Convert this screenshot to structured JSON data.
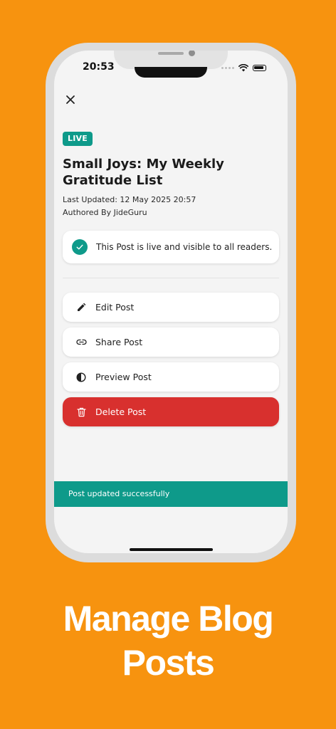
{
  "status_bar": {
    "time": "20:53"
  },
  "post": {
    "badge": "LIVE",
    "title": "Small Joys: My Weekly Gratitude List",
    "last_updated": "Last Updated: 12 May 2025 20:57",
    "author": "Authored By JideGuru"
  },
  "notice": {
    "text": "This Post is live and visible to all readers.",
    "icon": "check-icon"
  },
  "actions": [
    {
      "label": "Edit Post",
      "icon": "pencil-icon"
    },
    {
      "label": "Share Post",
      "icon": "link-icon"
    },
    {
      "label": "Preview Post",
      "icon": "contrast-icon"
    },
    {
      "label": "Delete Post",
      "icon": "trash-icon"
    }
  ],
  "snackbar": {
    "text": "Post updated successfully"
  },
  "headline": {
    "line1": "Manage Blog",
    "line2": "Posts"
  },
  "colors": {
    "background": "#F7930F",
    "accent": "#0E9A8A",
    "danger": "#D8302E"
  }
}
